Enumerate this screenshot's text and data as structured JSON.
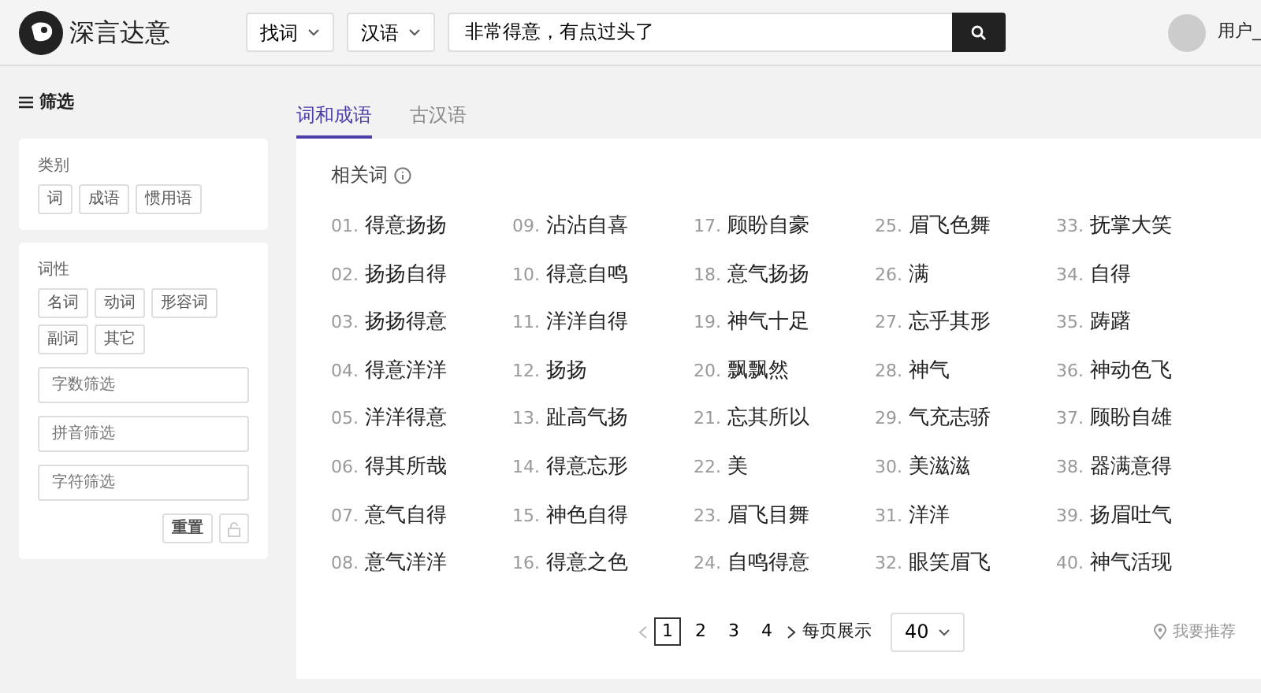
{
  "header": {
    "brand": "深言达意",
    "mode_select": "找词",
    "language_select": "汉语",
    "search": {
      "value": "非常得意，有点过头了"
    },
    "user": "用户_"
  },
  "sidebar": {
    "title": "筛选",
    "groups": [
      {
        "label": "类别",
        "tags": [
          {
            "label": "词",
            "selected": false
          },
          {
            "label": "成语",
            "selected": false
          },
          {
            "label": "惯用语",
            "selected": false
          }
        ]
      },
      {
        "label": "词性",
        "tags": [
          {
            "label": "名词",
            "selected": false
          },
          {
            "label": "动词",
            "selected": false
          },
          {
            "label": "形容词",
            "selected": false
          },
          {
            "label": "副词",
            "selected": false
          },
          {
            "label": "其它",
            "selected": false
          }
        ],
        "fields": [
          {
            "placeholder": "字数筛选"
          },
          {
            "placeholder": "拼音筛选"
          },
          {
            "placeholder": "字符筛选"
          }
        ],
        "reset": "重置"
      }
    ]
  },
  "tabs": [
    {
      "label": "词和成语",
      "selected": true
    },
    {
      "label": "古汉语",
      "selected": false
    }
  ],
  "section_title": "相关词",
  "words": [
    {
      "index": "01.",
      "word": "得意扬扬"
    },
    {
      "index": "02.",
      "word": "扬扬自得"
    },
    {
      "index": "03.",
      "word": "扬扬得意"
    },
    {
      "index": "04.",
      "word": "得意洋洋"
    },
    {
      "index": "05.",
      "word": "洋洋得意"
    },
    {
      "index": "06.",
      "word": "得其所哉"
    },
    {
      "index": "07.",
      "word": "意气自得"
    },
    {
      "index": "08.",
      "word": "意气洋洋"
    },
    {
      "index": "09.",
      "word": "沾沾自喜"
    },
    {
      "index": "10.",
      "word": "得意自鸣"
    },
    {
      "index": "11.",
      "word": "洋洋自得"
    },
    {
      "index": "12.",
      "word": "扬扬"
    },
    {
      "index": "13.",
      "word": "趾高气扬"
    },
    {
      "index": "14.",
      "word": "得意忘形"
    },
    {
      "index": "15.",
      "word": "神色自得"
    },
    {
      "index": "16.",
      "word": "得意之色"
    },
    {
      "index": "17.",
      "word": "顾盼自豪"
    },
    {
      "index": "18.",
      "word": "意气扬扬"
    },
    {
      "index": "19.",
      "word": "神气十足"
    },
    {
      "index": "20.",
      "word": "飘飘然"
    },
    {
      "index": "21.",
      "word": "忘其所以"
    },
    {
      "index": "22.",
      "word": "美"
    },
    {
      "index": "23.",
      "word": "眉飞目舞"
    },
    {
      "index": "24.",
      "word": "自鸣得意"
    },
    {
      "index": "25.",
      "word": "眉飞色舞"
    },
    {
      "index": "26.",
      "word": "满"
    },
    {
      "index": "27.",
      "word": "忘乎其形"
    },
    {
      "index": "28.",
      "word": "神气"
    },
    {
      "index": "29.",
      "word": "气充志骄"
    },
    {
      "index": "30.",
      "word": "美滋滋"
    },
    {
      "index": "31.",
      "word": "洋洋"
    },
    {
      "index": "32.",
      "word": "眼笑眉飞"
    },
    {
      "index": "33.",
      "word": "抚掌大笑"
    },
    {
      "index": "34.",
      "word": "自得"
    },
    {
      "index": "35.",
      "word": "踌躇"
    },
    {
      "index": "36.",
      "word": "神动色飞"
    },
    {
      "index": "37.",
      "word": "顾盼自雄"
    },
    {
      "index": "38.",
      "word": "器满意得"
    },
    {
      "index": "39.",
      "word": "扬眉吐气"
    },
    {
      "index": "40.",
      "word": "神气活现"
    }
  ],
  "pagination": {
    "pages": [
      {
        "label": "1",
        "selected": true
      },
      {
        "label": "2",
        "selected": false
      },
      {
        "label": "3",
        "selected": false
      },
      {
        "label": "4",
        "selected": false
      }
    ],
    "per_page_label": "每页展示",
    "per_page": "40"
  },
  "recommend": "我要推荐"
}
